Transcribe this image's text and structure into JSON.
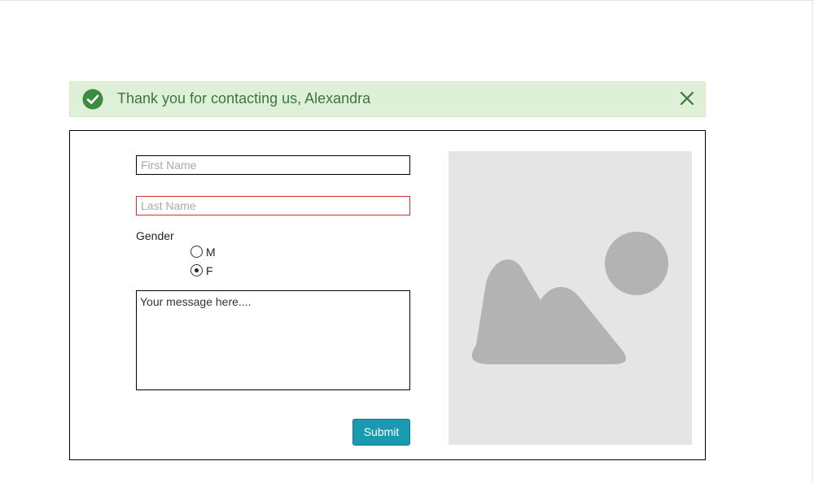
{
  "alert": {
    "message": "Thank you for contacting us, Alexandra",
    "icon": "check-circle-icon",
    "close_icon": "close-icon",
    "colors": {
      "background": "#dff0d8",
      "text": "#3c763d",
      "icon": "#3c8c40"
    }
  },
  "form": {
    "first_name": {
      "value": "",
      "placeholder": "First Name"
    },
    "last_name": {
      "value": "",
      "placeholder": "Last Name"
    },
    "gender": {
      "label": "Gender",
      "options": [
        {
          "label": "M",
          "selected": false
        },
        {
          "label": "F",
          "selected": true
        }
      ]
    },
    "message": {
      "value": "Your message here...."
    },
    "submit_label": "Submit"
  },
  "image": {
    "icon": "image-placeholder-icon"
  },
  "colors": {
    "accent": "#1a9ab0",
    "error_border": "#cc3333",
    "placeholder_bg": "#e5e5e5",
    "placeholder_shape": "#b3b3b3"
  }
}
